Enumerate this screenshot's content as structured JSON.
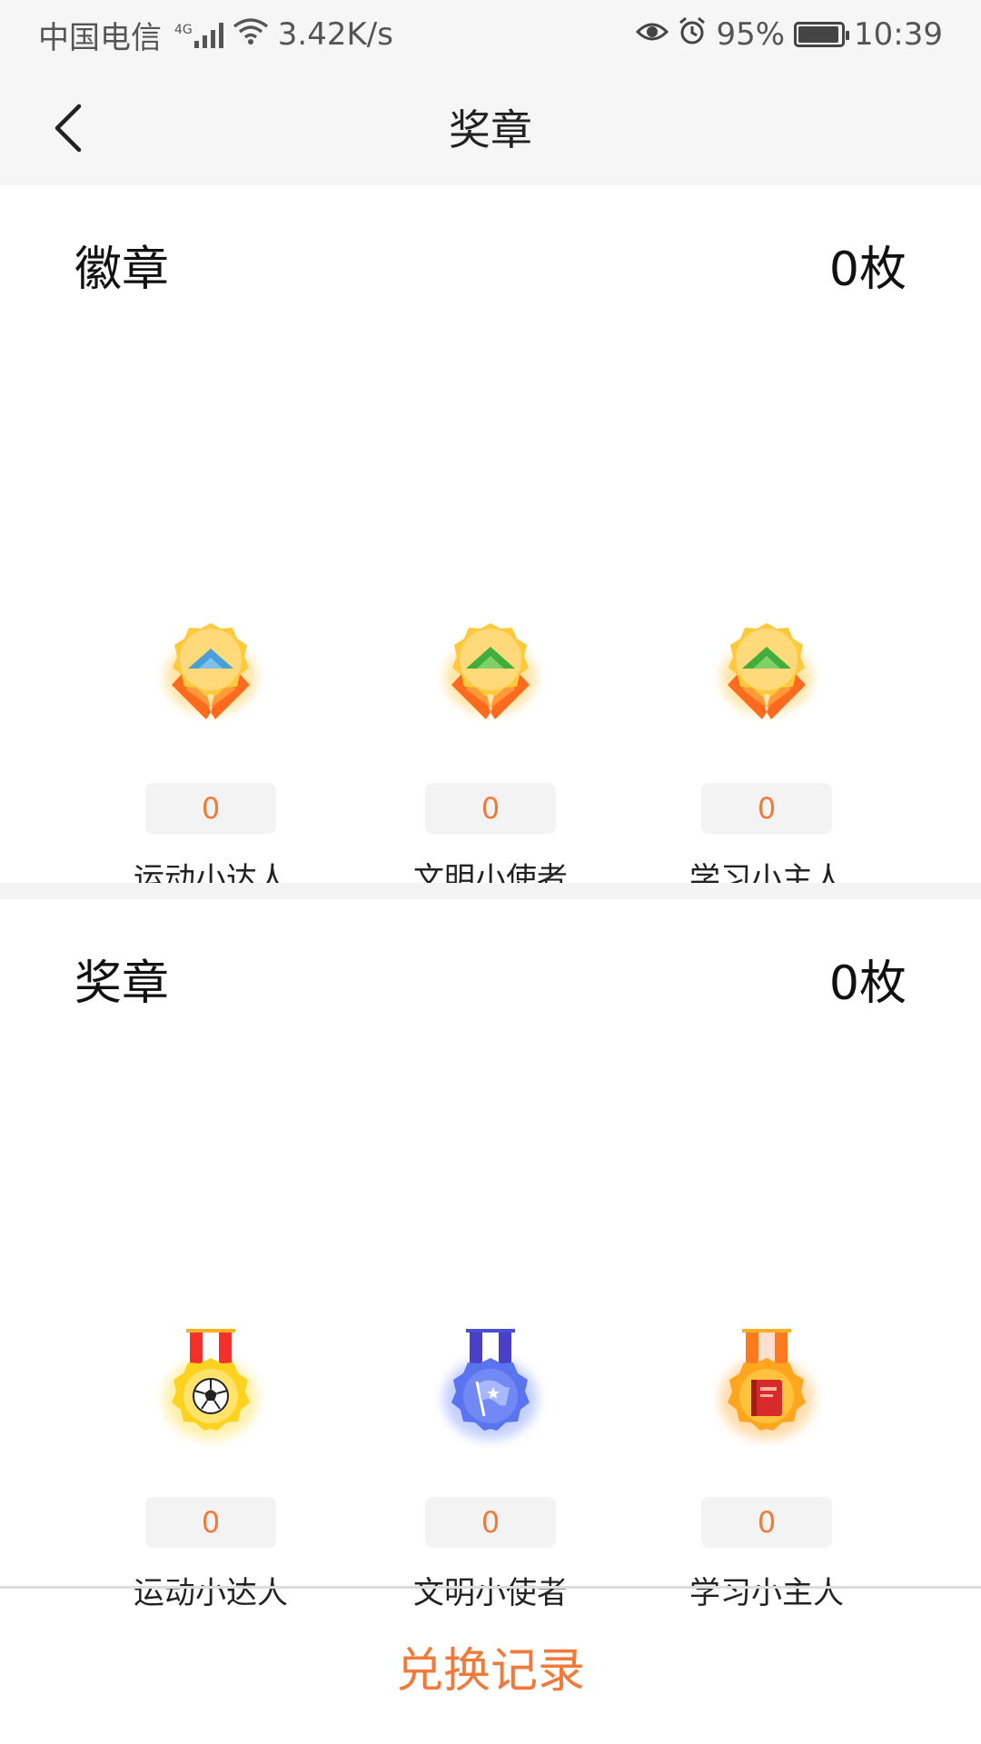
{
  "status_bar": {
    "carrier": "中国电信",
    "network": "4G",
    "speed": "3.42K/s",
    "battery": "95%",
    "battery_level": 0.95,
    "time": "10:39"
  },
  "nav": {
    "title": "奖章"
  },
  "badges_section": {
    "title": "徽章",
    "count": "0枚",
    "items": [
      {
        "count": "0",
        "label": "运动小达人",
        "icon": "badge-blue-stripe-icon"
      },
      {
        "count": "0",
        "label": "文明小使者",
        "icon": "badge-green-stripe-icon"
      },
      {
        "count": "0",
        "label": "学习小主人",
        "icon": "badge-green-stripe-icon"
      }
    ]
  },
  "medals_section": {
    "title": "奖章",
    "count": "0枚",
    "items": [
      {
        "count": "0",
        "label": "运动小达人",
        "icon": "soccer-medal-icon"
      },
      {
        "count": "0",
        "label": "文明小使者",
        "icon": "flag-medal-icon"
      },
      {
        "count": "0",
        "label": "学习小主人",
        "icon": "book-medal-icon"
      }
    ]
  },
  "footer": {
    "exchange_label": "兑换记录"
  },
  "colors": {
    "accent": "#f07a3a",
    "header_bg": "#f6f6f6",
    "pill_bg": "#f3f3f3"
  }
}
